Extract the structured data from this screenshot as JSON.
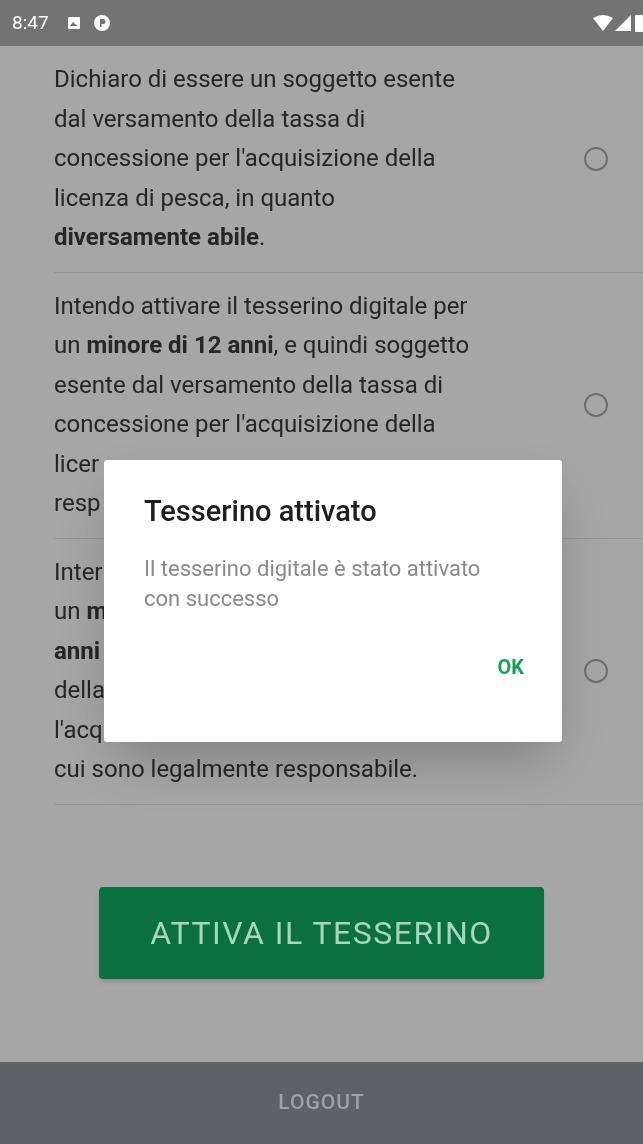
{
  "status_bar": {
    "time": "8:47"
  },
  "options": [
    {
      "lines": [
        "Dichiaro di essere un soggetto esente",
        "dal versamento della tassa di",
        "concessione per l'acquisizione della",
        "licenza di pesca, in quanto",
        "**diversamente abile**."
      ],
      "selected": false
    },
    {
      "lines": [
        "Intendo attivare il tesserino digitale per",
        "un **minore di 12 anni**, e quindi soggetto",
        "esente dal versamento della tassa di",
        "concessione per l'acquisizione della",
        "licer",
        "resp"
      ],
      "selected": false
    },
    {
      "lines": [
        "Inter",
        "un **m**",
        "**anni**",
        "della",
        "l'acq",
        "cui sono legalmente responsabile."
      ],
      "selected": false
    }
  ],
  "activate_button": "ATTIVA IL TESSERINO",
  "logout": "LOGOUT",
  "dialog": {
    "title": "Tesserino attivato",
    "message": "Il tesserino digitale è stato attivato con successo",
    "ok": "OK"
  }
}
